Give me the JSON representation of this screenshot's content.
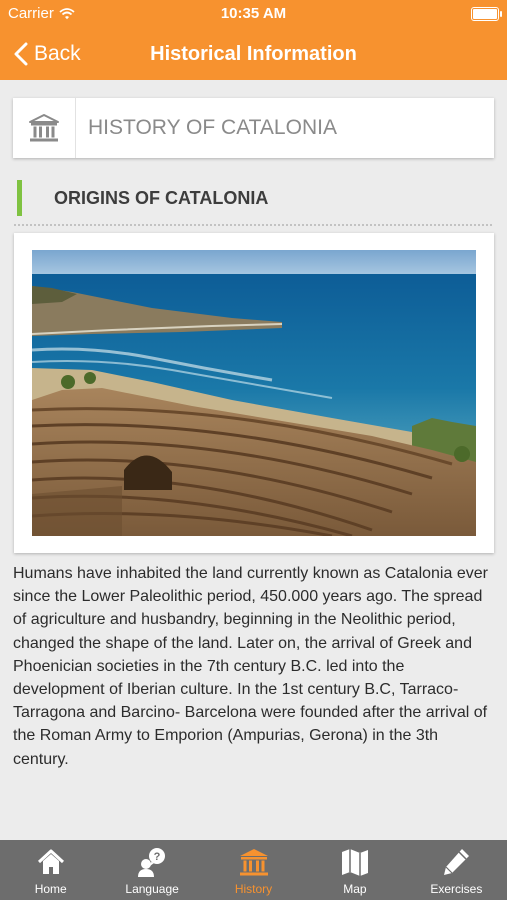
{
  "status_bar": {
    "carrier": "Carrier",
    "time": "10:35 AM"
  },
  "nav": {
    "back_label": "Back",
    "title": "Historical Information"
  },
  "header": {
    "icon": "museum-icon",
    "title": "HISTORY OF CATALONIA"
  },
  "section": {
    "title": "ORIGINS OF CATALONIA"
  },
  "photo": {
    "subject": "roman-amphitheatre-by-sea"
  },
  "body_text": "Humans have inhabited the land currently known as Catalonia ever since the Lower Paleolithic period, 450.000 years ago. The spread of agriculture and husbandry, beginning in the Neolithic period, changed the shape of the land. Later on, the arrival of Greek and Phoenician societies in the 7th century B.C. led into the development of Iberian culture. In the 1st century B.C, Tarraco-Tarragona and Barcino- Barcelona were founded after the arrival of the Roman Army to Emporion (Ampurias, Gerona) in the 3th century.",
  "tabs": [
    {
      "label": "Home",
      "icon": "home-icon",
      "active": false
    },
    {
      "label": "Language",
      "icon": "language-icon",
      "active": false
    },
    {
      "label": "History",
      "icon": "museum-icon",
      "active": true
    },
    {
      "label": "Map",
      "icon": "map-icon",
      "active": false
    },
    {
      "label": "Exercises",
      "icon": "pencil-icon",
      "active": false
    }
  ],
  "colors": {
    "accent": "#f7922f",
    "section_bar": "#7fc241",
    "tabbar": "#6d6d6d",
    "background": "#ececec"
  }
}
